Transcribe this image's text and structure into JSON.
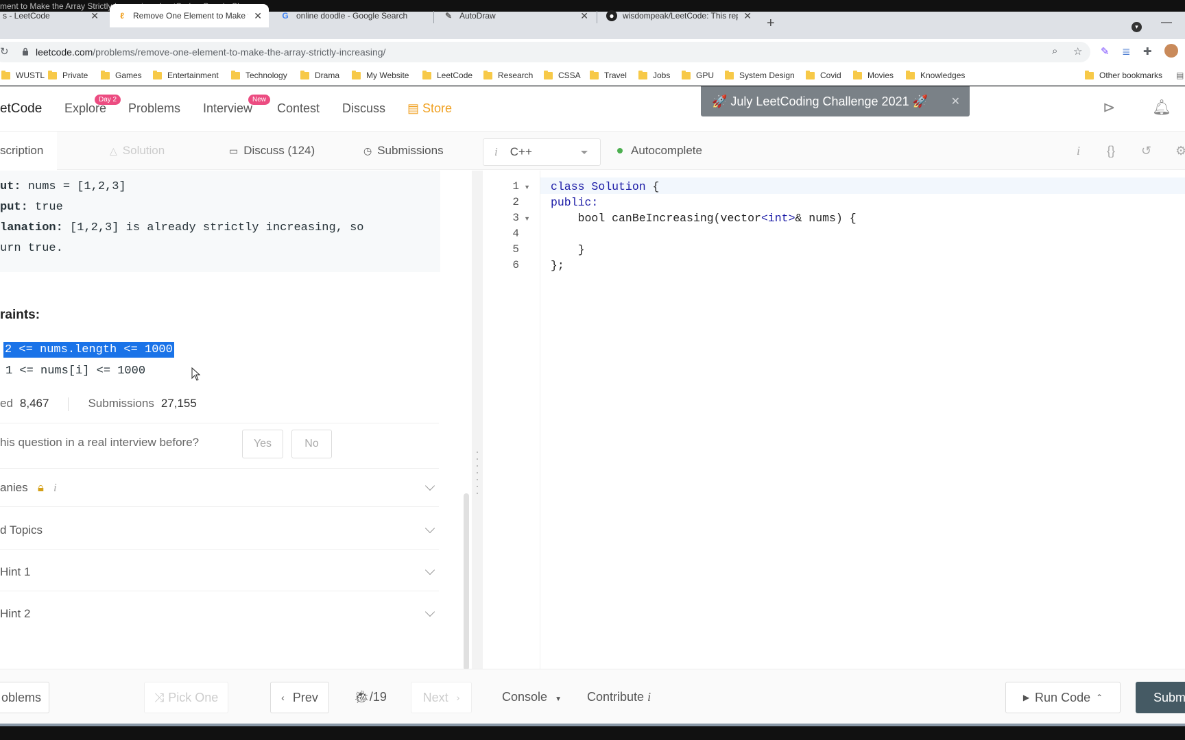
{
  "window": {
    "title": "ment to Make the Array Strictly Increasing - LeetCode - Google Chrome"
  },
  "tabs": [
    {
      "label": "s - LeetCode",
      "icon": "leetcode-icon"
    },
    {
      "label": "Remove One Element to Make th",
      "icon": "leetcode-icon",
      "active": true
    },
    {
      "label": "online doodle - Google Search",
      "icon": "google-icon"
    },
    {
      "label": "AutoDraw",
      "icon": "autodraw-icon"
    },
    {
      "label": "wisdompeak/LeetCode: This repo",
      "icon": "github-icon"
    }
  ],
  "address": {
    "host": "leetcode.com",
    "path": "/problems/remove-one-element-to-make-the-array-strictly-increasing/"
  },
  "bookmarks": [
    "WUSTL",
    "Private",
    "Games",
    "Entertainment",
    "Technology",
    "Drama",
    "My Website",
    "LeetCode",
    "Research",
    "CSSA",
    "Travel",
    "Jobs",
    "GPU",
    "System Design",
    "Covid",
    "Movies",
    "Knowledges"
  ],
  "other_bookmarks": "Other bookmarks",
  "nav": {
    "logo": "etCode",
    "explore": "Explore",
    "explore_badge": "Day 2",
    "problems": "Problems",
    "interview": "Interview",
    "interview_badge": "New",
    "contest": "Contest",
    "discuss": "Discuss",
    "store": "Store",
    "banner": "🚀 July LeetCoding Challenge 2021 🚀"
  },
  "subtabs": {
    "description": "scription",
    "solution": "Solution",
    "discuss": "Discuss (124)",
    "submissions": "Submissions",
    "language": "C++",
    "autocomplete": "Autocomplete"
  },
  "example": {
    "input_label": "ut:",
    "input_value": " nums = [1,2,3]",
    "output_label": "put:",
    "output_value": " true",
    "explanation_label": "lanation:",
    "explanation_value": " [1,2,3] is already strictly increasing, so",
    "explanation_cont": "urn true."
  },
  "constraints": {
    "heading": "raints:",
    "line1": "2 <= nums.length <= 1000",
    "line2": "1 <= nums[i] <= 1000"
  },
  "stats": {
    "accepted_label": "ed",
    "accepted_value": "8,467",
    "submissions_label": "Submissions",
    "submissions_value": "27,155"
  },
  "interview_question": "his question in a real interview before?",
  "yes": "Yes",
  "no": "No",
  "accordions": {
    "companies": "anies",
    "topics": "d Topics",
    "hint1": "Hint 1",
    "hint2": "Hint 2"
  },
  "code": {
    "line_numbers": [
      "1",
      "2",
      "3",
      "4",
      "5",
      "6"
    ],
    "l1_kw": "class",
    "l1_cls": "Solution",
    "l1_rest": " {",
    "l2": "public:",
    "l3_type": "bool",
    "l3_a": " canBeIncreasing(vector",
    "l3_b": "<int>",
    "l3_c": "& nums) {",
    "l5": "    }",
    "l6": "};"
  },
  "footer": {
    "problems": "oblems",
    "pick_one": "Pick One",
    "prev": "Prev",
    "page": "/19",
    "next": "Next",
    "console": "Console",
    "contribute": "Contribute",
    "run_code": "Run Code",
    "submit": "Subm"
  }
}
